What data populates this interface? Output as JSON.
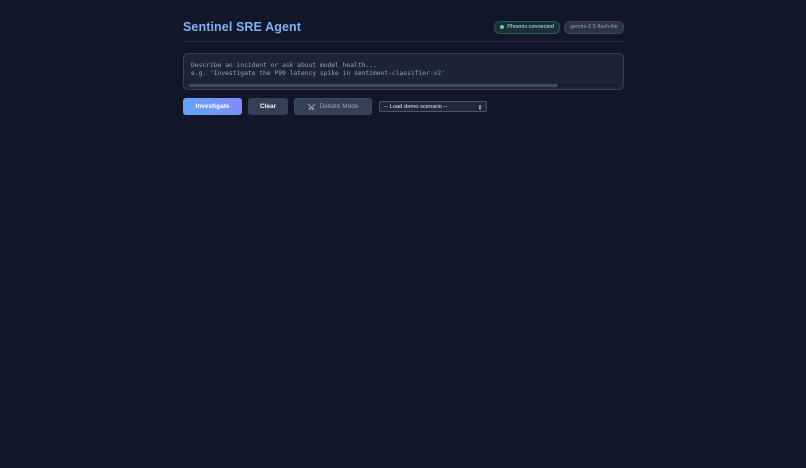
{
  "header": {
    "title": "Sentinel SRE Agent",
    "status_badge": "Phoenix connected",
    "model_badge": "gemini-2.5-flash-lite"
  },
  "prompt": {
    "placeholder": "Describe an incident or ask about model health...\ne.g. 'Investigate the P99 latency spike in sentiment-classifier-v2'",
    "value": ""
  },
  "actions": {
    "investigate_label": "Investigate",
    "clear_label": "Clear",
    "debate_label": "Debate Mode",
    "debate_icon": "swords-icon",
    "scenario_select": {
      "selected": "-- Load demo scenario --"
    }
  },
  "colors": {
    "background": "#111729",
    "title": "#7fb1f8",
    "status_dot": "#4ade80",
    "primary_gradient_start": "#60a5fa",
    "primary_gradient_end": "#818cf8"
  }
}
